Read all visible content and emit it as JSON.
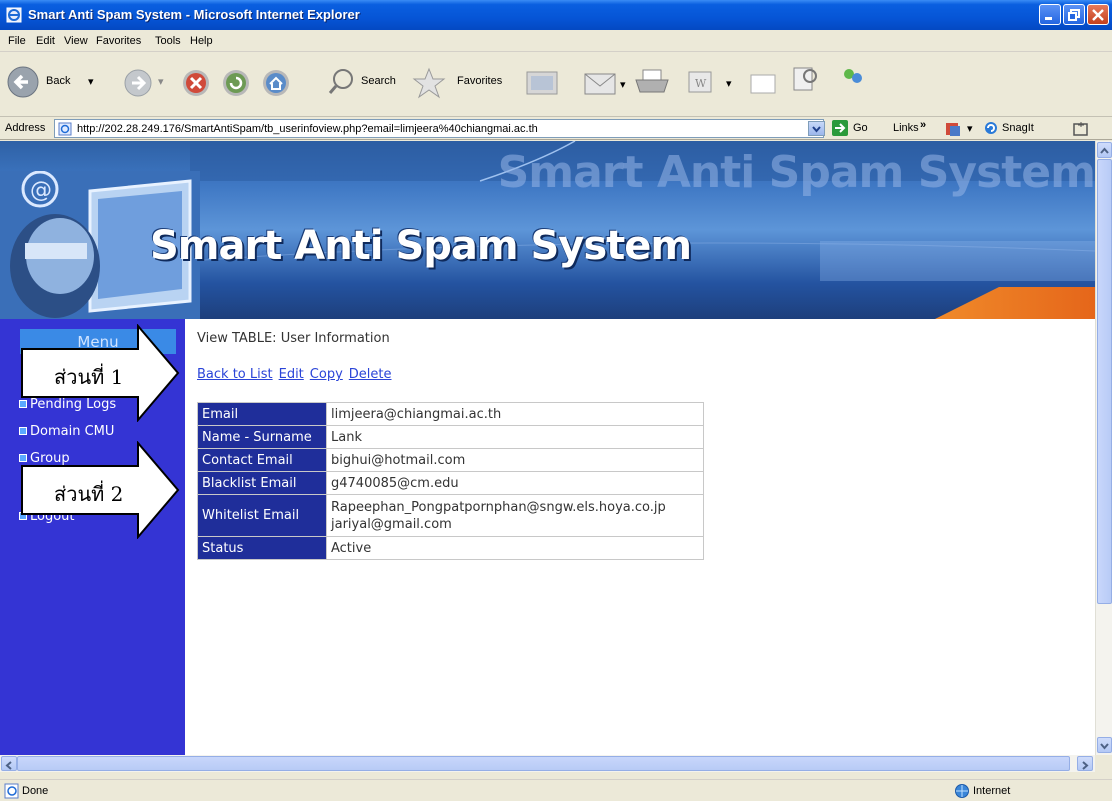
{
  "window": {
    "title": "Smart Anti Spam System - Microsoft Internet Explorer"
  },
  "menubar": [
    "File",
    "Edit",
    "View",
    "Favorites",
    "Tools",
    "Help"
  ],
  "toolbar": {
    "back_label": "Back",
    "search_label": "Search",
    "favorites_label": "Favorites"
  },
  "addressbar": {
    "label": "Address",
    "url": "http://202.28.249.176/SmartAntiSpam/tb_userinfoview.php?email=limjeera%40chiangmai.ac.th",
    "go_label": "Go",
    "links_label": "Links",
    "snagit_label": "SnagIt"
  },
  "banner": {
    "title": "Smart Anti Spam System",
    "background_title": "Smart Anti Spam System",
    "at_symbol": "@"
  },
  "sidebar": {
    "menu_header": "Menu",
    "items": [
      "Pending Logs",
      "Domain CMU",
      "Group",
      "Logout"
    ]
  },
  "content": {
    "view_title": "View TABLE: User Information",
    "links": [
      "Back to List",
      "Edit",
      "Copy",
      "Delete"
    ],
    "rows": [
      {
        "key": "Email",
        "value": "limjeera@chiangmai.ac.th"
      },
      {
        "key": "Name - Surname",
        "value": "Lank"
      },
      {
        "key": "Contact Email",
        "value": "bighui@hotmail.com"
      },
      {
        "key": "Blacklist Email",
        "value": "g4740085@cm.edu"
      },
      {
        "key": "Whitelist Email",
        "value": "Rapeephan_Pongpatpornphan@sngw.els.hoya.co.jp",
        "value2": "jariyal@gmail.com"
      },
      {
        "key": "Status",
        "value": "Active"
      }
    ]
  },
  "callouts": [
    "ส่วนที่ 1",
    "ส่วนที่ 2"
  ],
  "statusbar": {
    "status": "Done",
    "zone": "Internet"
  },
  "colors": {
    "sidebar": "#3434d4",
    "table_key_bg": "#1f2e9a",
    "link": "#2a44d8",
    "titlebar": "#0655d6"
  }
}
